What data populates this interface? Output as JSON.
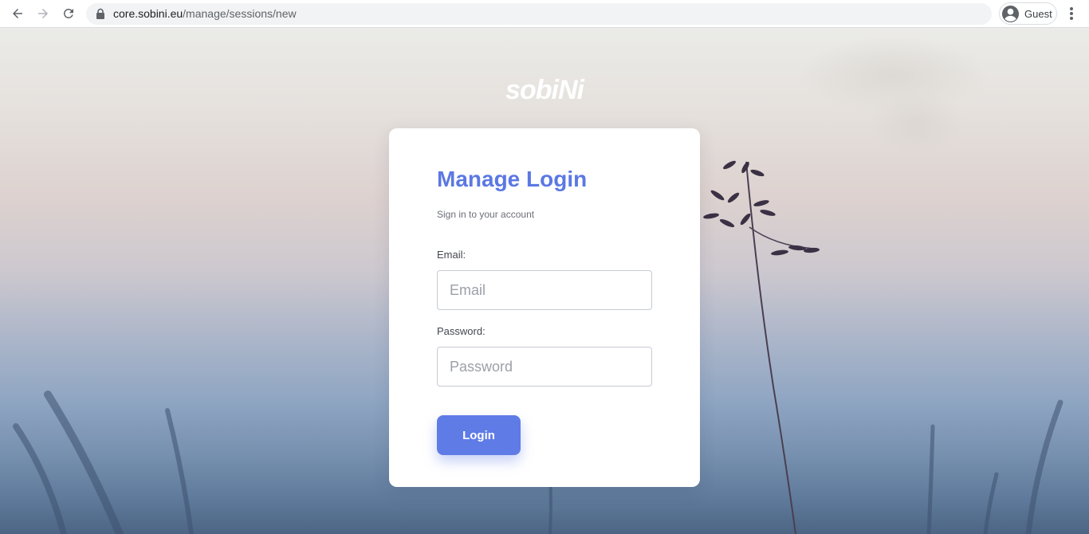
{
  "browser": {
    "url_domain": "core.sobini.eu",
    "url_path": "/manage/sessions/new",
    "profile_label": "Guest"
  },
  "brand": {
    "logo_text": "sobiNi"
  },
  "login": {
    "title": "Manage Login",
    "subtitle": "Sign in to your account",
    "email_label": "Email:",
    "email_placeholder": "Email",
    "password_label": "Password:",
    "password_placeholder": "Password",
    "submit_label": "Login"
  },
  "colors": {
    "accent": "#5f7be6",
    "title": "#5b78e3"
  },
  "icons": [
    "back-arrow-icon",
    "forward-arrow-icon",
    "reload-icon",
    "lock-icon",
    "account-circle-icon",
    "more-vert-icon"
  ]
}
